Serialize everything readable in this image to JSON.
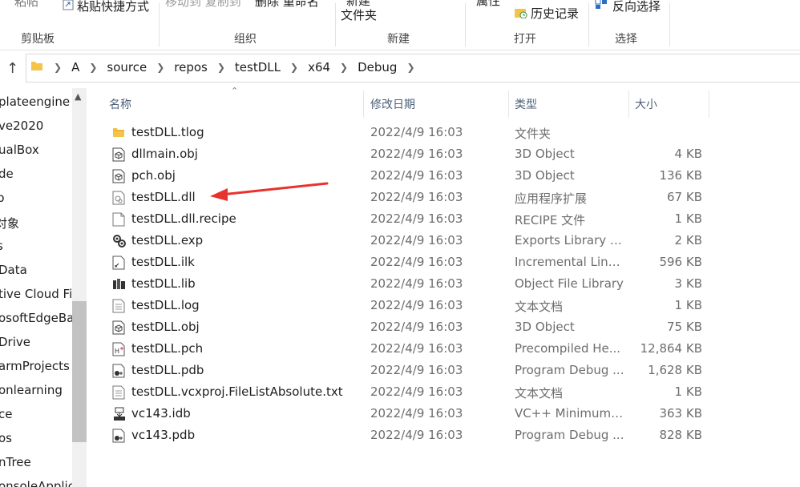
{
  "ribbon": {
    "fragments": [
      "粘帖",
      "粘贴快捷方式",
      "移动到 复制到",
      "删除 重命名",
      "新建",
      "文件夹",
      "属性",
      "历史记录",
      "反向选择"
    ],
    "groups": [
      "剪贴板",
      "组织",
      "新建",
      "打开",
      "选择"
    ]
  },
  "address": {
    "crumbs": [
      "A",
      "source",
      "repos",
      "testDLL",
      "x64",
      "Debug"
    ]
  },
  "nav": {
    "items": [
      "plateengine",
      "ve2020",
      "ualBox",
      "de",
      "p",
      "对象",
      "s",
      "Data",
      "tive Cloud Fil",
      "osoftEdgeBa",
      "Drive",
      "armProjects",
      "onlearning",
      "ce",
      "os",
      "nTree",
      "onsoleApplic"
    ]
  },
  "columns": {
    "name": "名称",
    "date": "修改日期",
    "type": "类型",
    "size": "大小"
  },
  "files": [
    {
      "name": "testDLL.tlog",
      "date": "2022/4/9 16:03",
      "type": "文件夹",
      "size": "",
      "icon": "folder-icon"
    },
    {
      "name": "dllmain.obj",
      "date": "2022/4/9 16:03",
      "type": "3D Object",
      "size": "4 KB",
      "icon": "3d-object-icon"
    },
    {
      "name": "pch.obj",
      "date": "2022/4/9 16:03",
      "type": "3D Object",
      "size": "136 KB",
      "icon": "3d-object-icon"
    },
    {
      "name": "testDLL.dll",
      "date": "2022/4/9 16:03",
      "type": "应用程序扩展",
      "size": "67 KB",
      "icon": "dll-icon"
    },
    {
      "name": "testDLL.dll.recipe",
      "date": "2022/4/9 16:03",
      "type": "RECIPE 文件",
      "size": "1 KB",
      "icon": "blank-file-icon"
    },
    {
      "name": "testDLL.exp",
      "date": "2022/4/9 16:03",
      "type": "Exports Library F...",
      "size": "2 KB",
      "icon": "exp-icon"
    },
    {
      "name": "testDLL.ilk",
      "date": "2022/4/9 16:03",
      "type": "Incremental Link...",
      "size": "596 KB",
      "icon": "ilk-icon"
    },
    {
      "name": "testDLL.lib",
      "date": "2022/4/9 16:03",
      "type": "Object File Library",
      "size": "3 KB",
      "icon": "lib-icon"
    },
    {
      "name": "testDLL.log",
      "date": "2022/4/9 16:03",
      "type": "文本文档",
      "size": "1 KB",
      "icon": "text-file-icon"
    },
    {
      "name": "testDLL.obj",
      "date": "2022/4/9 16:03",
      "type": "3D Object",
      "size": "75 KB",
      "icon": "3d-object-icon"
    },
    {
      "name": "testDLL.pch",
      "date": "2022/4/9 16:03",
      "type": "Precompiled He...",
      "size": "12,864 KB",
      "icon": "pch-icon"
    },
    {
      "name": "testDLL.pdb",
      "date": "2022/4/9 16:03",
      "type": "Program Debug ...",
      "size": "1,628 KB",
      "icon": "pdb-icon"
    },
    {
      "name": "testDLL.vcxproj.FileListAbsolute.txt",
      "date": "2022/4/9 16:03",
      "type": "文本文档",
      "size": "1 KB",
      "icon": "text-file-icon"
    },
    {
      "name": "vc143.idb",
      "date": "2022/4/9 16:03",
      "type": "VC++ Minimum ...",
      "size": "363 KB",
      "icon": "idb-icon"
    },
    {
      "name": "vc143.pdb",
      "date": "2022/4/9 16:03",
      "type": "Program Debug ...",
      "size": "828 KB",
      "icon": "pdb-icon"
    }
  ],
  "colors": {
    "annotation_arrow": "#e8322e",
    "folder": "#f3c34a",
    "header_text": "#4c607a"
  }
}
